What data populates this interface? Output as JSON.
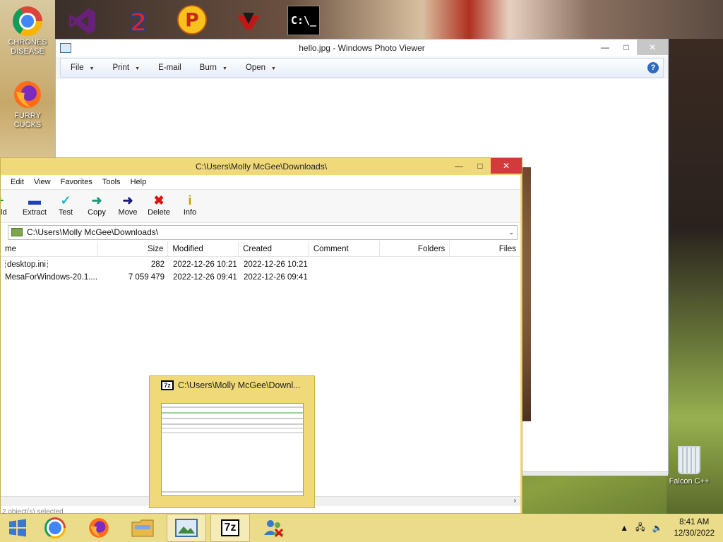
{
  "desktop": {
    "icons": [
      {
        "name": "chrome",
        "label": "CHRONES DISEASE"
      },
      {
        "name": "visual-studio",
        "label": ""
      },
      {
        "name": "two",
        "label": ""
      },
      {
        "name": "p",
        "label": ""
      },
      {
        "name": "persona",
        "label": ""
      },
      {
        "name": "cmd",
        "label": ""
      },
      {
        "name": "firefox",
        "label": "FURRY CUCKS"
      }
    ],
    "recycle_bin_label": "Falcon C++",
    "cmd_glyph": "C:\\_"
  },
  "photo_viewer": {
    "title": "hello.jpg - Windows Photo Viewer",
    "menu": [
      "File",
      "Print",
      "E-mail",
      "Burn",
      "Open"
    ],
    "help": "?"
  },
  "sevenzip": {
    "title": "C:\\Users\\Molly McGee\\Downloads\\",
    "menu": [
      "Edit",
      "View",
      "Favorites",
      "Tools",
      "Help"
    ],
    "toolbar": [
      "ld",
      "Extract",
      "Test",
      "Copy",
      "Move",
      "Delete",
      "Info"
    ],
    "address": "C:\\Users\\Molly McGee\\Downloads\\",
    "columns": [
      "me",
      "Size",
      "Modified",
      "Created",
      "Comment",
      "Folders",
      "Files"
    ],
    "rows": [
      {
        "name": "desktop.ini",
        "size": "282",
        "modified": "2022-12-26 10:21",
        "created": "2022-12-26 10:21"
      },
      {
        "name": "MesaForWindows-20.1....",
        "size": "7 059 479",
        "modified": "2022-12-26 09:41",
        "created": "2022-12-26 09:41"
      }
    ],
    "status": "2 object(s) selected"
  },
  "thumbnail": {
    "title": "C:\\Users\\Molly McGee\\Downl...",
    "icon_text": "7z"
  },
  "taskbar": {
    "clock_time": "8:41 AM",
    "clock_date": "12/30/2022",
    "sevenzip_label": "7z"
  }
}
